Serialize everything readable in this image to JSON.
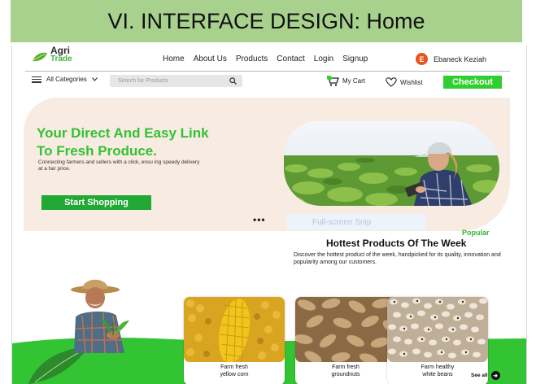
{
  "slide_title": "VI. INTERFACE DESIGN: Home",
  "logo": {
    "line1": "Agri",
    "line2": "Trade"
  },
  "nav": {
    "items": [
      "Home",
      "About Us",
      "Products",
      "Contact",
      "Login",
      "Signup"
    ]
  },
  "user": {
    "initial": "E",
    "name": "Ebaneck Keziah"
  },
  "toolbar": {
    "categories_label": "All Categories",
    "search_placeholder": "Search for Products",
    "cart_label": "My Cart",
    "wishlist_label": "Wishlist",
    "checkout_label": "Checkout"
  },
  "hero": {
    "headline_line1": "Your Direct And Easy Link",
    "headline_line2": "To Fresh Produce.",
    "subtext": "Connecting farmers and sellers with a click, ensu ing speedy delivery at a fair price.",
    "cta_label": "Start Shopping"
  },
  "overlay": {
    "dots": "•••",
    "snip_label": "Full-screen Snip"
  },
  "popular": {
    "eyebrow": "Popular",
    "title": "Hottest Products Of The Week",
    "description": "Discover the hottest product of the week, handpicked for its quality, innovation and popularity among our customers."
  },
  "products": [
    {
      "line1": "Farm fresh",
      "line2": "yellow corn"
    },
    {
      "line1": "Farm fresh",
      "line2": "groundnuts"
    },
    {
      "line1": "Farm healthy",
      "line2": "white beans"
    }
  ],
  "see_all_label": "See all",
  "colors": {
    "brand_green": "#2fcf2f",
    "banner_green": "#a9d18e",
    "hero_bg": "#f7ebe2",
    "avatar": "#e8521c"
  }
}
